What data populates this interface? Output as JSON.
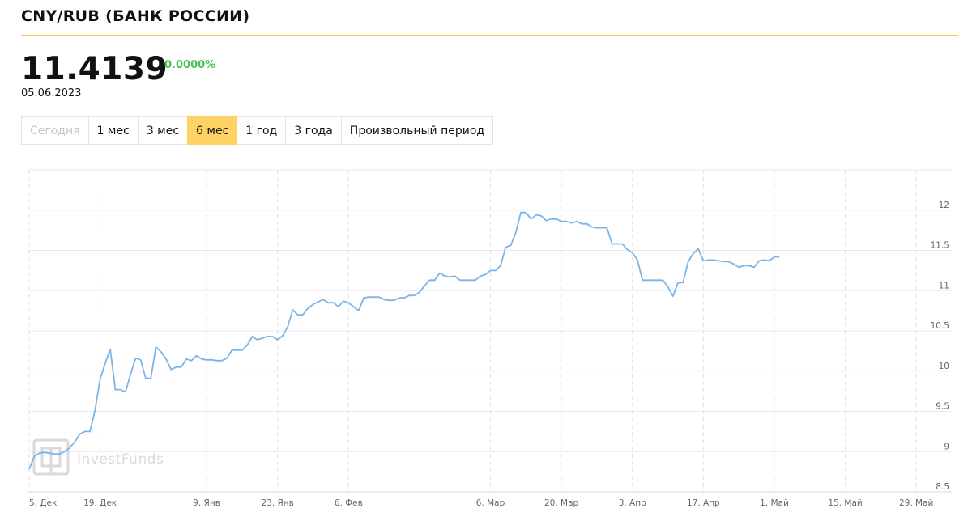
{
  "header": {
    "title": "CNY/RUB (БАНК РОССИИ)",
    "price": "11.4139",
    "change": "0.0000%",
    "date": "05.06.2023"
  },
  "periods": [
    {
      "label": "Сегодня",
      "state": "disabled"
    },
    {
      "label": "1 мес",
      "state": "normal"
    },
    {
      "label": "3 мес",
      "state": "normal"
    },
    {
      "label": "6 мес",
      "state": "active"
    },
    {
      "label": "1 год",
      "state": "normal"
    },
    {
      "label": "3 года",
      "state": "normal"
    },
    {
      "label": "Произвольный период",
      "state": "normal"
    }
  ],
  "colors": {
    "line": "#7db4e6",
    "active_tab": "#ffd266",
    "change_positive": "#4cc05a",
    "title_rule": "#f3cc4a"
  },
  "watermark": "InvestFunds",
  "chart_data": {
    "type": "line",
    "title": "",
    "xlabel": "",
    "ylabel": "",
    "ylim": [
      8.5,
      12.5
    ],
    "yticks": [
      8.5,
      9,
      9.5,
      10,
      10.5,
      11,
      11.5,
      12
    ],
    "grid": true,
    "x_ticks": [
      "5. Дек",
      "19. Дек",
      "9. Янв",
      "23. Янв",
      "6. Фев",
      "6. Мар",
      "20. Мар",
      "3. Апр",
      "17. Апр",
      "1. Май",
      "15. Май",
      "29. Май"
    ],
    "x_tick_index": [
      0,
      14,
      35,
      49,
      63,
      91,
      105,
      119,
      133,
      147,
      161,
      175
    ],
    "series": [
      {
        "name": "",
        "x_index": [
          0,
          1,
          2,
          3,
          4,
          5,
          6,
          7,
          8,
          9,
          10,
          11,
          12,
          13,
          14,
          15,
          16,
          17,
          18,
          19,
          20,
          21,
          22,
          23,
          24,
          25,
          26,
          27,
          28,
          29,
          30,
          31,
          32,
          33,
          34,
          35,
          36,
          37,
          38,
          39,
          40,
          41,
          42,
          43,
          44,
          45,
          46,
          47,
          48,
          49,
          50,
          51,
          52,
          53,
          54,
          55,
          56,
          57,
          58,
          59,
          60,
          61,
          62,
          63,
          64,
          65,
          66,
          67,
          68,
          69,
          70,
          71,
          72,
          73,
          74,
          75,
          76,
          77,
          78,
          79,
          80,
          81,
          82,
          83,
          84,
          85,
          86,
          87,
          88,
          89,
          90,
          91,
          92,
          93,
          94,
          95,
          96,
          97,
          98,
          99,
          100,
          101,
          102,
          103,
          104,
          105,
          106,
          107,
          108,
          109,
          110,
          111,
          112,
          113,
          114,
          115,
          116,
          117,
          118,
          119,
          120,
          121,
          122,
          123,
          124,
          125,
          126,
          127,
          128,
          129,
          130,
          131,
          132,
          133,
          134,
          135,
          136,
          137,
          138,
          139,
          140,
          141,
          142,
          143,
          144,
          145,
          146,
          147,
          148,
          149,
          150,
          151,
          152,
          153,
          154,
          155,
          156,
          157,
          158,
          159,
          160,
          161,
          162,
          163,
          164,
          165,
          166,
          167,
          168,
          169,
          170,
          171,
          172,
          173,
          174,
          175,
          176,
          177,
          178,
          179,
          180,
          181,
          182
        ],
        "values": [
          8.78,
          8.94,
          8.98,
          8.99,
          8.98,
          8.97,
          8.97,
          9.0,
          9.05,
          9.12,
          9.22,
          9.25,
          9.25,
          9.52,
          9.9,
          10.1,
          10.27,
          9.77,
          9.77,
          9.74,
          9.96,
          10.16,
          10.14,
          9.91,
          9.91,
          10.3,
          10.24,
          10.15,
          10.02,
          10.05,
          10.05,
          10.15,
          10.13,
          10.19,
          10.15,
          10.14,
          10.14,
          10.13,
          10.13,
          10.16,
          10.26,
          10.26,
          10.26,
          10.32,
          10.43,
          10.39,
          10.41,
          10.43,
          10.43,
          10.39,
          10.44,
          10.55,
          10.76,
          10.7,
          10.7,
          10.78,
          10.83,
          10.86,
          10.89,
          10.85,
          10.85,
          10.8,
          10.87,
          10.85,
          10.8,
          10.75,
          10.91,
          10.92,
          10.92,
          10.92,
          10.89,
          10.88,
          10.88,
          10.91,
          10.91,
          10.94,
          10.94,
          10.98,
          11.06,
          11.13,
          11.13,
          11.22,
          11.18,
          11.17,
          11.18,
          11.13,
          11.13,
          11.13,
          11.13,
          11.18,
          11.2,
          11.25,
          11.25,
          11.31,
          11.54,
          11.56,
          11.72,
          11.97,
          11.97,
          11.89,
          11.94,
          11.93,
          11.87,
          11.89,
          11.89,
          11.86,
          11.86,
          11.84,
          11.86,
          11.83,
          11.83,
          11.79,
          11.78,
          11.78,
          11.78,
          11.58,
          11.58,
          11.58,
          11.51,
          11.47,
          11.38,
          11.13,
          11.13,
          11.13,
          11.13,
          11.13,
          11.05,
          10.93,
          11.1,
          11.1,
          11.36,
          11.46,
          11.52,
          11.37,
          11.38,
          11.38,
          11.37,
          11.36,
          11.36,
          11.33,
          11.29,
          11.31,
          11.31,
          11.29,
          11.37,
          11.38,
          11.37,
          11.42,
          11.42
        ]
      }
    ]
  }
}
